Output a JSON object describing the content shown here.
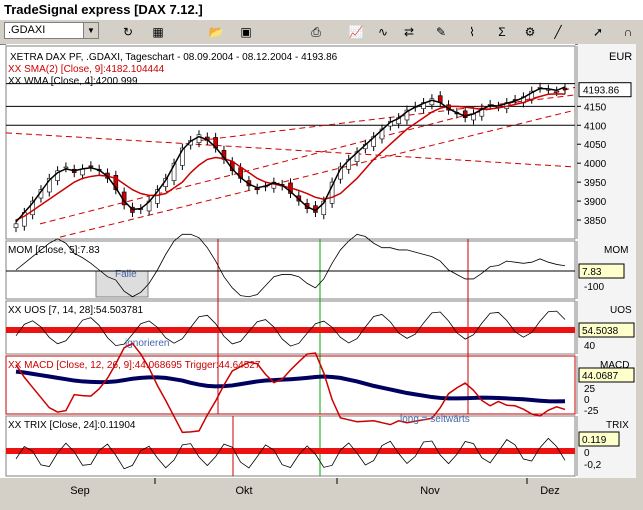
{
  "window": {
    "title": "TradeSignal express [DAX 7.12.]"
  },
  "toolbar": {
    "symbol_value": ".GDAXI",
    "icons": [
      "refresh-icon",
      "calculator-icon",
      "open-folder-icon",
      "save-icon",
      "print-icon",
      "chart-icon",
      "indicator-icon",
      "compare-icon",
      "draw-tool-icon",
      "pattern-icon",
      "sum-icon",
      "settings-icon",
      "line-tool-icon",
      "pointer-icon",
      "magnet-icon"
    ]
  },
  "colors": {
    "sma": "#cc0000",
    "wma": "#000000",
    "up_candle": "#ffffff",
    "down_candle": "#cc0000",
    "macd": "#cc0000",
    "trigger": "#000060",
    "band": "#ee1111",
    "grid": "#000000",
    "vline_red": "#cc0000",
    "vline_green": "#00aa00"
  },
  "price_panel": {
    "currency": "EUR",
    "legend": [
      "XETRA DAX PF, .GDAXI, Tageschart - 08.09.2004 - 08.12.2004 - 4193.86",
      "XX SMA(2) [Close, 9]:4182.104444",
      "XX WMA [Close, 4]:4200.999"
    ],
    "last_value": "4193.86",
    "y_ticks": [
      "4150",
      "4100",
      "4050",
      "4000",
      "3950",
      "3900",
      "3850"
    ]
  },
  "mom_panel": {
    "legend": "MOM [Close, 5]:7.83",
    "title": "MOM",
    "last_value": "7.83",
    "y_ticks": [
      "-100"
    ],
    "annotation": "Falle"
  },
  "uos_panel": {
    "legend": "XX UOS [7, 14, 28]:54.503781",
    "title": "UOS",
    "last_value": "54.5038",
    "y_ticks": [
      "40"
    ],
    "annotation": "ignorieren"
  },
  "macd_panel": {
    "legend": "XX MACD [Close, 12, 26, 9]:44.068695 Trigger:44.64527",
    "title": "MACD",
    "last_value": "44.0687",
    "y_ticks": [
      "25",
      "0",
      "-25"
    ]
  },
  "trix_panel": {
    "legend": "XX TRIX [Close, 24]:0.11904",
    "title": "TRIX",
    "last_value": "0.119",
    "y_ticks": [
      "0",
      "-0,2"
    ],
    "annotation": "long   =   seitwärts"
  },
  "x_axis": {
    "labels": [
      "Sep",
      "Okt",
      "Nov",
      "Dez"
    ]
  },
  "chart_data": {
    "type": "candlestick",
    "title": "XETRA DAX PF, .GDAXI, Tageschart - 08.09.2004 - 08.12.2004 - 4193.86",
    "ylim": [
      3800,
      4230
    ],
    "x_labels": [
      "Sep",
      "Okt",
      "Nov",
      "Dez"
    ],
    "close": [
      3840,
      3870,
      3900,
      3930,
      3960,
      3980,
      3990,
      3975,
      3985,
      3990,
      3980,
      3960,
      3930,
      3890,
      3870,
      3880,
      3900,
      3930,
      3960,
      4000,
      4040,
      4060,
      4075,
      4060,
      4040,
      4010,
      3980,
      3960,
      3940,
      3930,
      3940,
      3950,
      3940,
      3920,
      3900,
      3880,
      3870,
      3900,
      3950,
      3990,
      4010,
      4030,
      4050,
      4070,
      4090,
      4110,
      4120,
      4140,
      4150,
      4160,
      4170,
      4160,
      4140,
      4130,
      4120,
      4130,
      4145,
      4155,
      4150,
      4160,
      4165,
      4175,
      4190,
      4200,
      4195,
      4190,
      4193.86
    ],
    "sma9": [
      3850,
      3860,
      3875,
      3890,
      3905,
      3920,
      3935,
      3950,
      3960,
      3965,
      3968,
      3966,
      3960,
      3945,
      3930,
      3920,
      3915,
      3915,
      3920,
      3935,
      3950,
      3975,
      3995,
      4010,
      4015,
      4012,
      4005,
      3990,
      3975,
      3960,
      3950,
      3945,
      3940,
      3935,
      3928,
      3920,
      3910,
      3905,
      3910,
      3920,
      3940,
      3960,
      3985,
      4010,
      4030,
      4050,
      4070,
      4090,
      4105,
      4120,
      4135,
      4145,
      4150,
      4150,
      4148,
      4145,
      4142,
      4143,
      4146,
      4150,
      4155,
      4160,
      4168,
      4176,
      4182,
      4183,
      4182.1
    ],
    "wma4": [
      3845,
      3870,
      3895,
      3925,
      3955,
      3975,
      3985,
      3980,
      3985,
      3988,
      3982,
      3965,
      3935,
      3900,
      3878,
      3880,
      3898,
      3925,
      3955,
      3995,
      4035,
      4058,
      4070,
      4062,
      4042,
      4015,
      3985,
      3962,
      3945,
      3935,
      3940,
      3948,
      3942,
      3925,
      3905,
      3885,
      3875,
      3895,
      3940,
      3985,
      4008,
      4028,
      4048,
      4068,
      4088,
      4108,
      4118,
      4136,
      4148,
      4158,
      4166,
      4160,
      4144,
      4133,
      4124,
      4130,
      4142,
      4152,
      4151,
      4158,
      4164,
      4173,
      4186,
      4197,
      4196,
      4192,
      4201.0
    ]
  }
}
